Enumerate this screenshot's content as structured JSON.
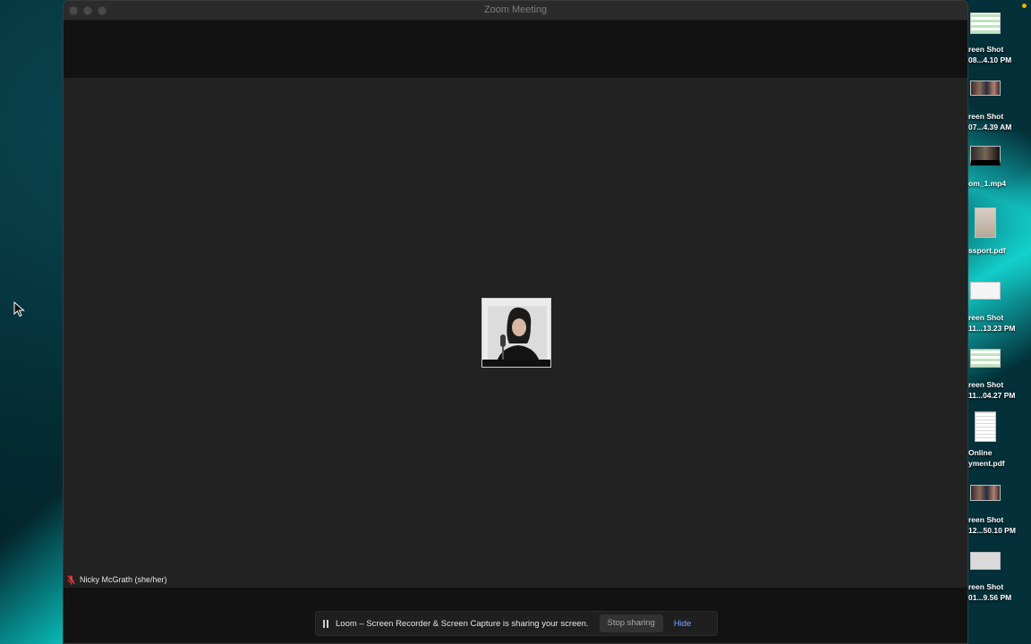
{
  "window": {
    "title": "Zoom Meeting"
  },
  "participant": {
    "name": "Nicky McGrath (she/her)"
  },
  "share_bar": {
    "message": "Loom – Screen Recorder & Screen Capture is sharing your screen.",
    "stop_label": "Stop sharing",
    "hide_label": "Hide"
  },
  "desktop_icons": [
    {
      "line1": "reen Shot",
      "line2": "08...4.10 PM",
      "kind": "sheet"
    },
    {
      "line1": "reen Shot",
      "line2": "07...4.39 AM",
      "kind": "photo"
    },
    {
      "line1": "",
      "line2": "om_1.mp4",
      "kind": "vid"
    },
    {
      "line1": "",
      "line2": "ssport.pdf",
      "kind": "pdf"
    },
    {
      "line1": "reen Shot",
      "line2": "11...13.23 PM",
      "kind": "doc-wide"
    },
    {
      "line1": "reen Shot",
      "line2": "11...04.27 PM",
      "kind": "sheet"
    },
    {
      "line1": "Online",
      "line2": "yment.pdf",
      "kind": "doc"
    },
    {
      "line1": "reen Shot",
      "line2": "12...50.10 PM",
      "kind": "photo"
    },
    {
      "line1": "reen Shot",
      "line2": "01...9.56 PM",
      "kind": "doc-wide"
    }
  ],
  "colors": {
    "meeting_bg": "#222222",
    "band_bg": "#121212",
    "hide_link": "#7ea5ff",
    "wallpaper_accent": "#19ebe1"
  },
  "icons": {
    "mute": "muted-mic-icon",
    "pause": "pause-icon",
    "cursor": "mouse-cursor-icon"
  }
}
